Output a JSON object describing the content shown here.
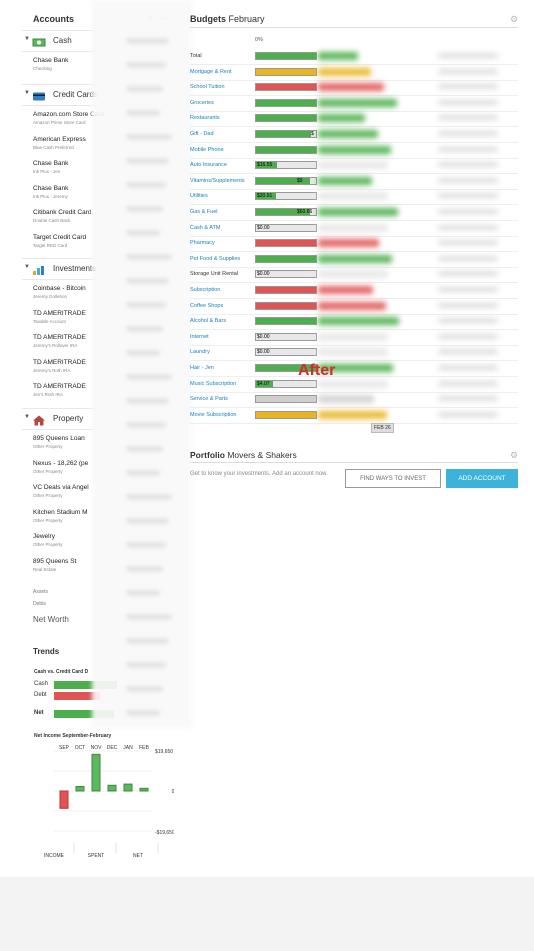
{
  "colors": {
    "green": "#4cae4c",
    "yellow": "#e9b422",
    "red": "#e05454",
    "brand_blue": "#3db3d9",
    "link": "#1a7fc1"
  },
  "sidebar": {
    "title": "Accounts",
    "tools": "⚙ ⇆",
    "sections": [
      {
        "label": "Cash",
        "icon": "cash-icon",
        "accounts": [
          {
            "name": "Chase Bank",
            "type": "Checking"
          }
        ]
      },
      {
        "label": "Credit Cards",
        "icon": "credit-card-icon",
        "accounts": [
          {
            "name": "Amazon.com Store Card",
            "type": "Amazon Prime Store Card"
          },
          {
            "name": "American Express",
            "type": "Blue Cash Preferred"
          },
          {
            "name": "Chase Bank",
            "type": "Ink Plus - Jen"
          },
          {
            "name": "Chase Bank",
            "type": "Ink Plus - Jeremy"
          },
          {
            "name": "Citibank Credit Card",
            "type": "Double Cash Back"
          },
          {
            "name": "Target Credit Card",
            "type": "Target RED Card"
          }
        ]
      },
      {
        "label": "Investments",
        "icon": "investment-icon",
        "accounts": [
          {
            "name": "Coinbase - Bitcoin",
            "type": "Jeremy Gollehon"
          },
          {
            "name": "TD AMERITRADE",
            "type": "Taxable Account"
          },
          {
            "name": "TD AMERITRADE",
            "type": "Jeremy's Rollover IRA"
          },
          {
            "name": "TD AMERITRADE",
            "type": "Jeremy's Roth IRA"
          },
          {
            "name": "TD AMERITRADE",
            "type": "Jen's Roth IRA"
          }
        ]
      },
      {
        "label": "Property",
        "icon": "house-icon",
        "accounts": [
          {
            "name": "895 Queens Loan",
            "type": "Other Property"
          },
          {
            "name": "Nexus - 18,262 (pe",
            "type": "Other Property"
          },
          {
            "name": "VC Deals via Angel",
            "type": "Other Property"
          },
          {
            "name": "Kitchen Stadium M",
            "type": "Other Property"
          },
          {
            "name": "Jewelry",
            "type": "Other Property"
          },
          {
            "name": "895 Queens St",
            "type": "Real Estate"
          }
        ]
      }
    ],
    "assets_label": "Assets",
    "debts_label": "Debts",
    "networth_label": "Net Worth"
  },
  "trends": {
    "title": "Trends",
    "subtitle": "Cash vs. Credit Card D",
    "cash_label": "Cash",
    "debt_label": "Debt",
    "net_label": "Net",
    "cash_level": 0.72,
    "debt_level": 0.52,
    "net_level": 0.68,
    "net_income": {
      "title": "Net Income September-February",
      "months": [
        "SEP",
        "OCT",
        "NOV",
        "DEC",
        "JAN",
        "FEB"
      ],
      "values": [
        -8500,
        2200,
        18000,
        2800,
        3400,
        1300
      ],
      "ymax": 19650,
      "ymax_label": "$19,650",
      "zero_label": "0",
      "ymin_label": "-$19,650",
      "footer": [
        "INCOME",
        "SPENT",
        "NET"
      ]
    }
  },
  "budgets": {
    "title_bold": "Budgets",
    "title_rest": " February",
    "pct_label": "0%",
    "rows": [
      {
        "cat": "Total",
        "color": "green",
        "fill": 1.0,
        "amt": "",
        "dark": true
      },
      {
        "cat": "Mortgage & Rent",
        "color": "yellow",
        "fill": 1.0,
        "amt": ""
      },
      {
        "cat": "School Tuition",
        "color": "red",
        "fill": 1.0,
        "amt": ""
      },
      {
        "cat": "Groceries",
        "color": "green",
        "fill": 1.0,
        "amt": ""
      },
      {
        "cat": "Restaurants",
        "color": "green",
        "fill": 1.0,
        "amt": ""
      },
      {
        "cat": "Gift - Dad",
        "color": "green",
        "fill": 0.92,
        "amt": "$"
      },
      {
        "cat": "Mobile Phone",
        "color": "green",
        "fill": 1.0,
        "amt": ""
      },
      {
        "cat": "Auto Insurance",
        "color": "green",
        "fill": 0.35,
        "amt": "$16.55"
      },
      {
        "cat": "Vitamins/Supplements",
        "color": "green",
        "fill": 0.9,
        "amt": "$9"
      },
      {
        "cat": "Utilities",
        "color": "green",
        "fill": 0.33,
        "amt": "$20.91"
      },
      {
        "cat": "Gas & Fuel",
        "color": "green",
        "fill": 0.9,
        "amt": "$60.66"
      },
      {
        "cat": "Cash & ATM",
        "color": "gray",
        "fill": 0.0,
        "amt": "$0.00"
      },
      {
        "cat": "Pharmacy",
        "color": "red",
        "fill": 1.0,
        "amt": ""
      },
      {
        "cat": "Pet Food & Supplies",
        "color": "green",
        "fill": 1.0,
        "amt": ""
      },
      {
        "cat": "Storage Unit Rental",
        "color": "gray",
        "fill": 0.0,
        "amt": "$0.00",
        "dark": true
      },
      {
        "cat": "Subscription",
        "color": "red",
        "fill": 1.0,
        "amt": ""
      },
      {
        "cat": "Coffee Shops",
        "color": "red",
        "fill": 1.0,
        "amt": ""
      },
      {
        "cat": "Alcohol & Bars",
        "color": "green",
        "fill": 1.0,
        "amt": ""
      },
      {
        "cat": "Internet",
        "color": "gray",
        "fill": 0.0,
        "amt": "$0.00"
      },
      {
        "cat": "Laundry",
        "color": "gray",
        "fill": 0.0,
        "amt": "$0.00"
      },
      {
        "cat": "Hair - Jen",
        "color": "green",
        "fill": 1.0,
        "amt": ""
      },
      {
        "cat": "Music Subscription",
        "color": "green",
        "fill": 0.28,
        "amt": "$4.07"
      },
      {
        "cat": "Service & Parts",
        "color": "gray",
        "fill": 1.0,
        "amt": ""
      },
      {
        "cat": "Movie Subscription",
        "color": "yellow",
        "fill": 1.0,
        "amt": ""
      }
    ],
    "feb_tag": "FEB 26",
    "annotation": "After"
  },
  "portfolio": {
    "title_bold": "Portfolio",
    "title_rest": " Movers & Shakers",
    "text": "Get to know your investments. Add an account now.",
    "find_button": "FIND WAYS TO INVEST",
    "add_button": "ADD ACCOUNT"
  }
}
